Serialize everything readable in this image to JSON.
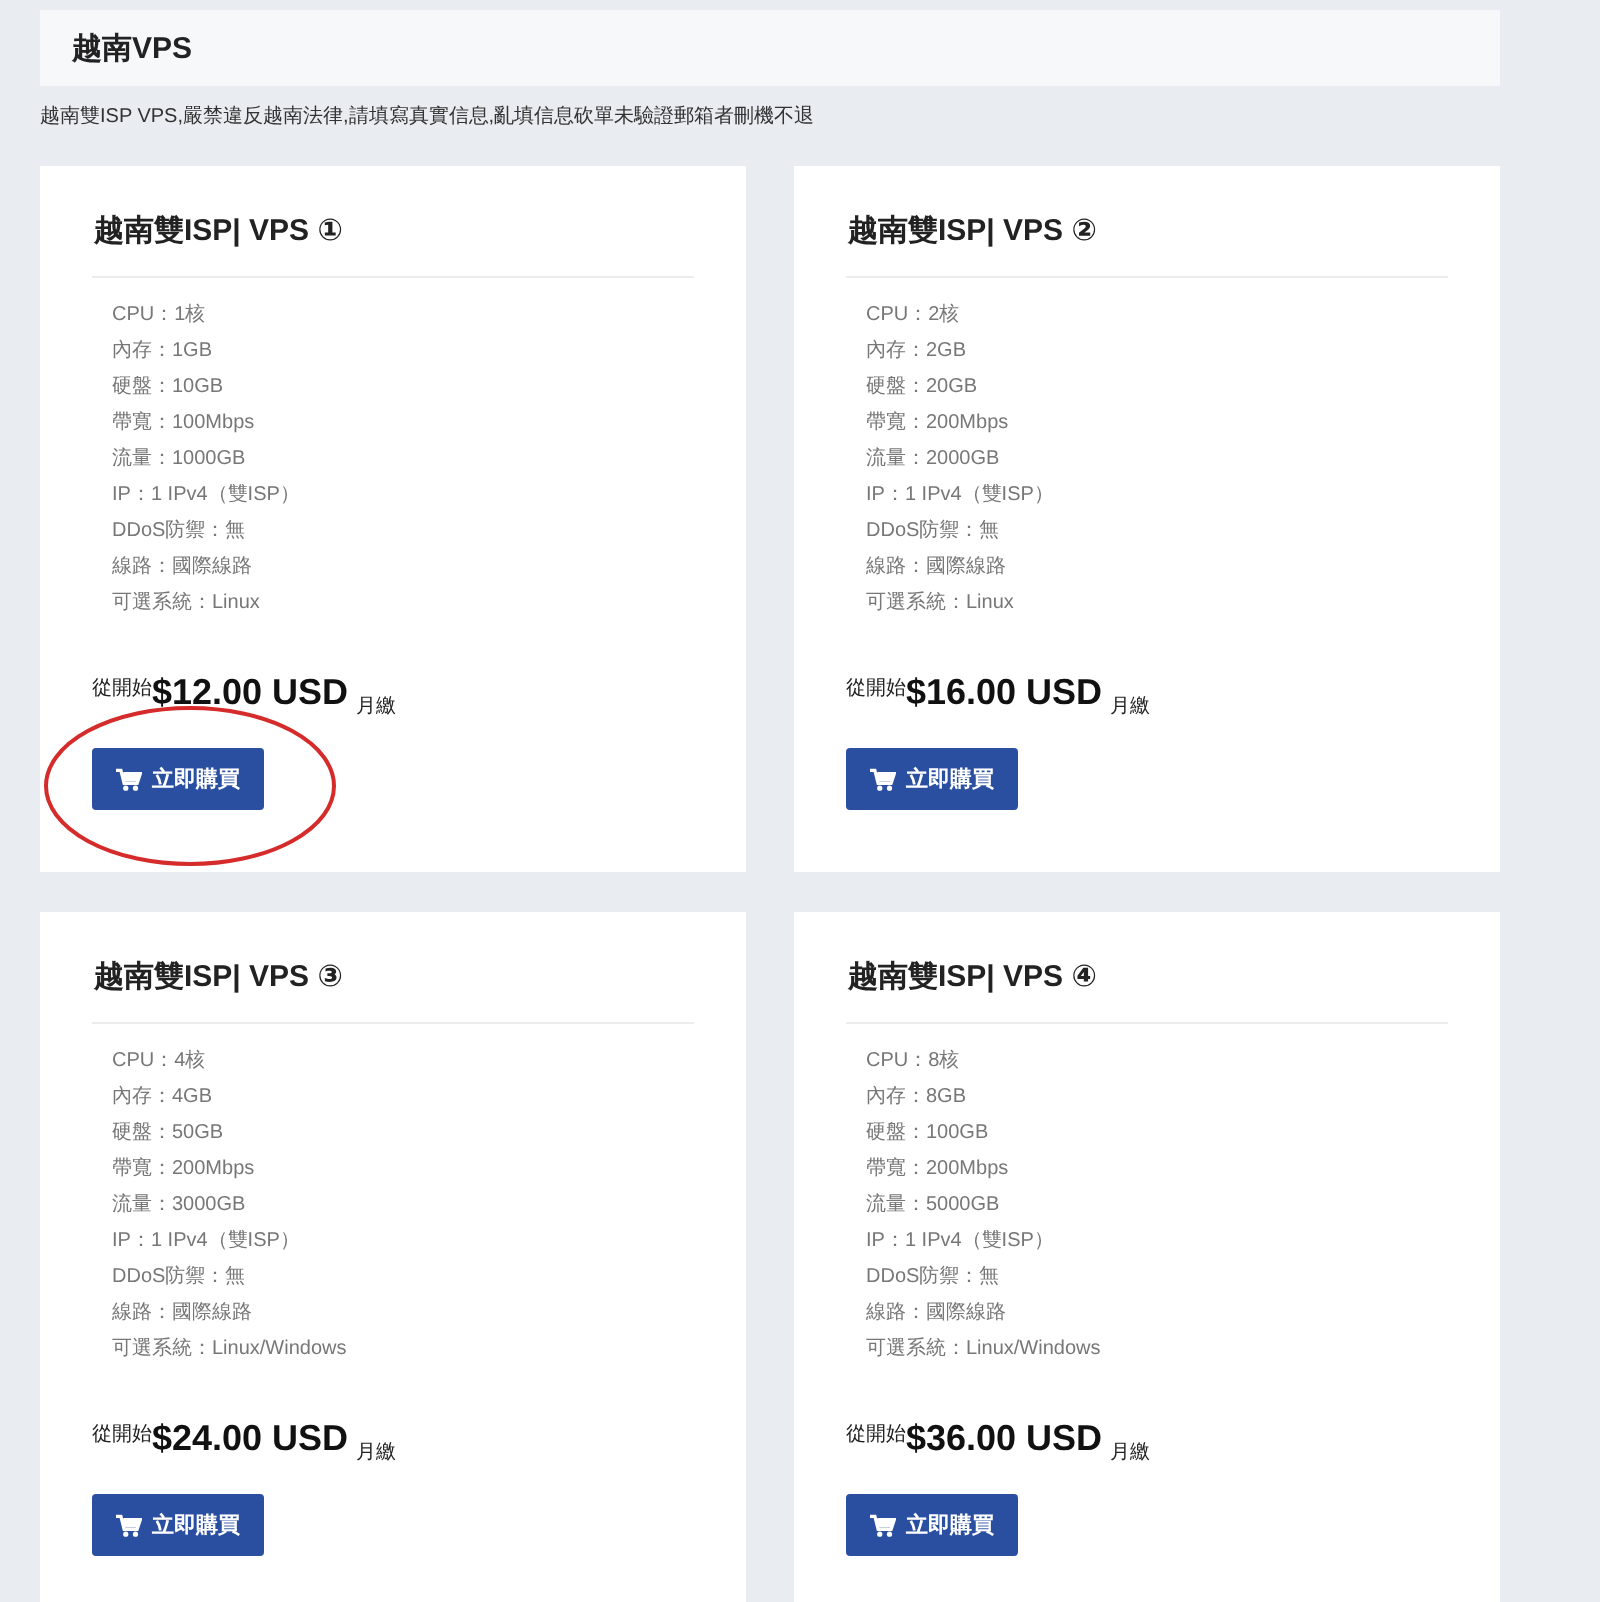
{
  "header": {
    "title": "越南VPS"
  },
  "notice": "越南雙ISP VPS,嚴禁違反越南法律,請填寫真實信息,亂填信息砍單未驗證郵箱者刪機不退",
  "plans": [
    {
      "title": "越南雙ISP| VPS ①",
      "specs": [
        "CPU：1核",
        "內存：1GB",
        "硬盤：10GB",
        "帶寬：100Mbps",
        "流量：1000GB",
        "IP：1 IPv4（雙ISP）",
        "DDoS防禦：無",
        "線路：國際線路",
        "可選系統：Linux"
      ],
      "price_prefix": "從開始",
      "price": "$12.00 USD",
      "period": "月繳",
      "button": "立即購買",
      "circled": true
    },
    {
      "title": "越南雙ISP| VPS ②",
      "specs": [
        "CPU：2核",
        "內存：2GB",
        "硬盤：20GB",
        "帶寬：200Mbps",
        "流量：2000GB",
        "IP：1 IPv4（雙ISP）",
        "DDoS防禦：無",
        "線路：國際線路",
        "可選系統：Linux"
      ],
      "price_prefix": "從開始",
      "price": "$16.00 USD",
      "period": "月繳",
      "button": "立即購買",
      "circled": false
    },
    {
      "title": "越南雙ISP| VPS ③",
      "specs": [
        "CPU：4核",
        "內存：4GB",
        "硬盤：50GB",
        "帶寬：200Mbps",
        "流量：3000GB",
        "IP：1 IPv4（雙ISP）",
        "DDoS防禦：無",
        "線路：國際線路",
        "可選系統：Linux/Windows"
      ],
      "price_prefix": "從開始",
      "price": "$24.00 USD",
      "period": "月繳",
      "button": "立即購買",
      "circled": false
    },
    {
      "title": "越南雙ISP| VPS ④",
      "specs": [
        "CPU：8核",
        "內存：8GB",
        "硬盤：100GB",
        "帶寬：200Mbps",
        "流量：5000GB",
        "IP：1 IPv4（雙ISP）",
        "DDoS防禦：無",
        "線路：國際線路",
        "可選系統：Linux/Windows"
      ],
      "price_prefix": "從開始",
      "price": "$36.00 USD",
      "period": "月繳",
      "button": "立即購買",
      "circled": false
    }
  ]
}
